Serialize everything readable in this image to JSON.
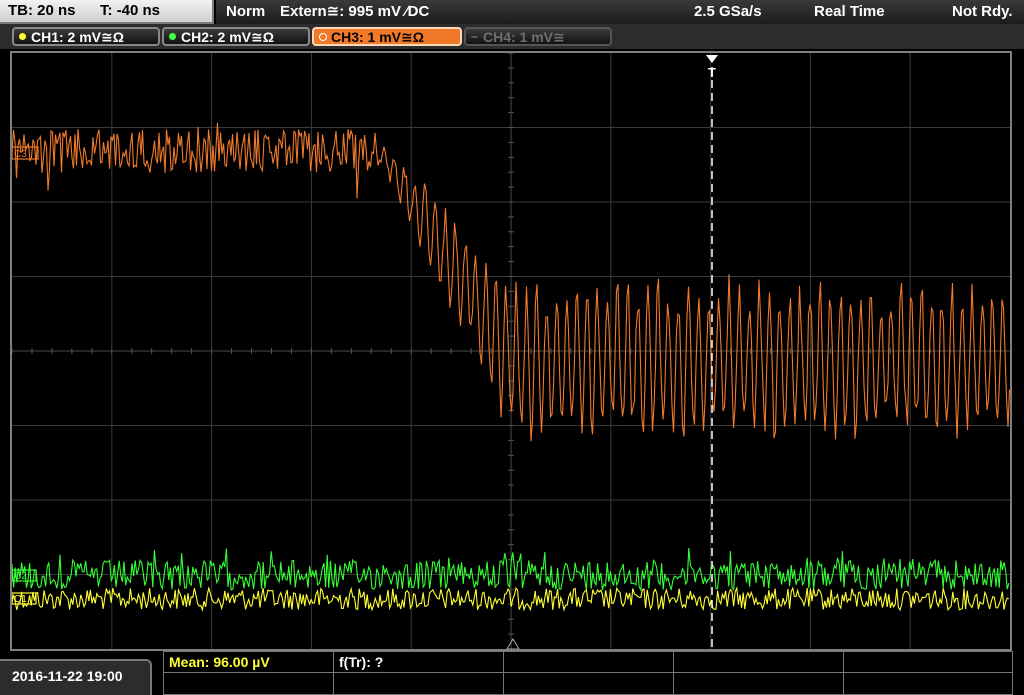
{
  "topbar": {
    "timebase": "TB: 20 ns",
    "trigger_time": "T: -40 ns",
    "mode": "Norm",
    "trigger_source": "Extern≅: 995 mV ∕DC",
    "sample_rate": "2.5 GSa/s",
    "acq_mode": "Real Time",
    "status": "Not Rdy."
  },
  "channels": [
    {
      "label": "CH1: 2 mV≅Ω",
      "color": "#ffff33",
      "state": "on"
    },
    {
      "label": "CH2: 2 mV≅Ω",
      "color": "#44ff44",
      "state": "on"
    },
    {
      "label": "CH3: 1 mV≅Ω",
      "color": "#f07a2a",
      "state": "active"
    },
    {
      "label": "CH4: 1 mV≅",
      "color": "#6f6f6f",
      "state": "off"
    }
  ],
  "markers": {
    "trigger": "T",
    "ch3": "C3",
    "ch2": "C2",
    "ch1": "C1"
  },
  "plot": {
    "grid_divisions": {
      "x": 10,
      "y": 8
    },
    "trace_colors": {
      "ch1": "#ffff33",
      "ch2": "#33ff33",
      "ch3": "#f07a2a"
    }
  },
  "bottom": {
    "datetime": "2016-11-22 19:00",
    "measurements": [
      {
        "label": "Mean: 96.00 µV",
        "color": "#ffff33"
      },
      {
        "label": "f(Tr): ?",
        "color": "#ffffff"
      }
    ]
  }
}
